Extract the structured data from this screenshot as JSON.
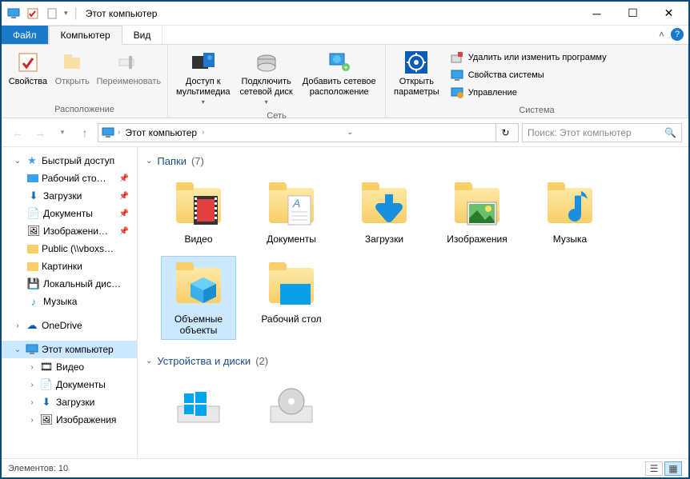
{
  "window": {
    "title": "Этот компьютер",
    "qat_separator": "|"
  },
  "tabs": {
    "file": "Файл",
    "computer": "Компьютер",
    "view": "Вид"
  },
  "ribbon": {
    "group_location": "Расположение",
    "group_network": "Сеть",
    "group_system": "Система",
    "properties": "Свойства",
    "open": "Открыть",
    "rename": "Переименовать",
    "media_access": "Доступ к\nмультимедиа",
    "map_drive": "Подключить\nсетевой диск",
    "add_net_location": "Добавить сетевое\nрасположение",
    "open_settings": "Открыть\nпараметры",
    "uninstall": "Удалить или изменить программу",
    "sys_properties": "Свойства системы",
    "manage": "Управление"
  },
  "address": {
    "root": "Этот компьютер"
  },
  "search": {
    "placeholder": "Поиск: Этот компьютер"
  },
  "tree": {
    "quick_access": "Быстрый доступ",
    "desktop": "Рабочий сто…",
    "downloads": "Загрузки",
    "documents": "Документы",
    "pictures": "Изображени…",
    "public": "Public (\\\\vboxs…",
    "pictures2": "Картинки",
    "local_disk": "Локальный дис…",
    "music": "Музыка",
    "onedrive": "OneDrive",
    "this_pc": "Этот компьютер",
    "videos": "Видео",
    "documents2": "Документы",
    "downloads2": "Загрузки",
    "pictures3": "Изображения"
  },
  "groups": {
    "folders": {
      "name": "Папки",
      "count": "(7)"
    },
    "devices": {
      "name": "Устройства и диски",
      "count": "(2)"
    }
  },
  "folders": [
    {
      "name": "Видео",
      "icon": "video"
    },
    {
      "name": "Документы",
      "icon": "documents"
    },
    {
      "name": "Загрузки",
      "icon": "downloads"
    },
    {
      "name": "Изображения",
      "icon": "pictures"
    },
    {
      "name": "Музыка",
      "icon": "music"
    },
    {
      "name": "Объемные объекты",
      "icon": "3d",
      "selected": true
    },
    {
      "name": "Рабочий стол",
      "icon": "desktop"
    }
  ],
  "status": {
    "elements": "Элементов: 10"
  }
}
